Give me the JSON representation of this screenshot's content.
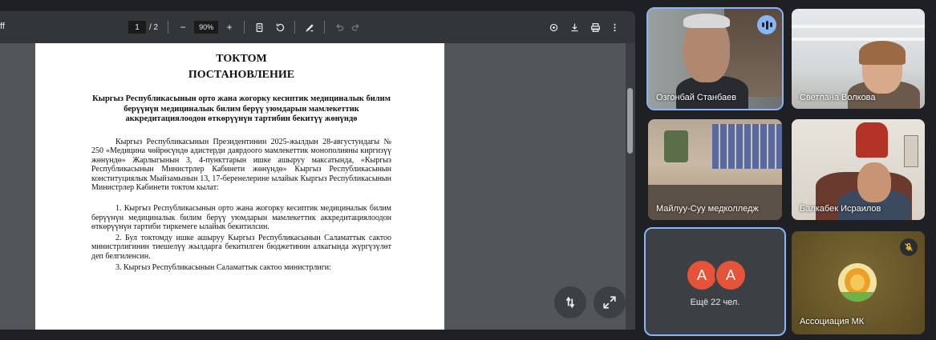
{
  "pdf": {
    "filename_fragment": "ff",
    "page_current": "1",
    "page_total": "/ 2",
    "zoom_minus": "−",
    "zoom_value": "90%",
    "zoom_plus": "+"
  },
  "document": {
    "title_1": "ТОКТОМ",
    "title_2": "ПОСТАНОВЛЕНИЕ",
    "subtitle": "Кыргыз Республикасынын орто жана жогорку кесиптик медициналык билим берүүнүн медициналык билим берүү уюмдарын мамлекеттик аккредитациялоодон өткөрүүнүн тартибин бекитүү жөнүндө",
    "para_1": "Кыргыз Республикасынын Президентинин 2025-жылдын 28-августундагы № 250 «Медицина чөйрөсүндө адистерди даярдоого мамлекеттик монополияны киргизүү жөнүндө» Жарлыгынын 3, 4-пункттарын ишке ашыруу максатында, «Кыргыз Республикасынын Министрлер Кабинети жөнүндө» Кыргыз Республикасынын конституциялык Мыйзамынын 13, 17-беренелерине ылайык Кыргыз Республикасынын Министрлер Кабинети токтом кылат:",
    "para_2": "1. Кыргыз Республикасынын орто жана жогорку кесиптик медициналык билим берүүнүн медициналык билим берүү уюмдарын мамлекеттик аккредитациялоодон өткөрүүнүн тартиби тиркемеге ылайык бекитилсин.",
    "para_3": "2. Бул токтомду ишке ашыруу Кыргыз Республикасынын Саламаттык сактоо министрлигинин тиешелүү жылдарга бекитилген бюджетинин алкагында жүргүзүлөт деп белгиленсин.",
    "para_4": "3. Кыргыз Республикасынын Саламаттык сактоо министрлиги:"
  },
  "participants": [
    {
      "name": "Озгонбай Станбаев"
    },
    {
      "name": "Светлана Волкова"
    },
    {
      "name": "Майлуу-Суу медколледж"
    },
    {
      "name": "Балкабек Исраилов"
    }
  ],
  "others": {
    "avatar_1": "А",
    "avatar_2": "А",
    "label": "Ещё 22 чел."
  },
  "association": {
    "name": "Ассоциация МК"
  },
  "colors": {
    "active_outline": "#8ab4f8",
    "avatar_bg": "#e5533a",
    "muted_icon": "#f4c542"
  }
}
